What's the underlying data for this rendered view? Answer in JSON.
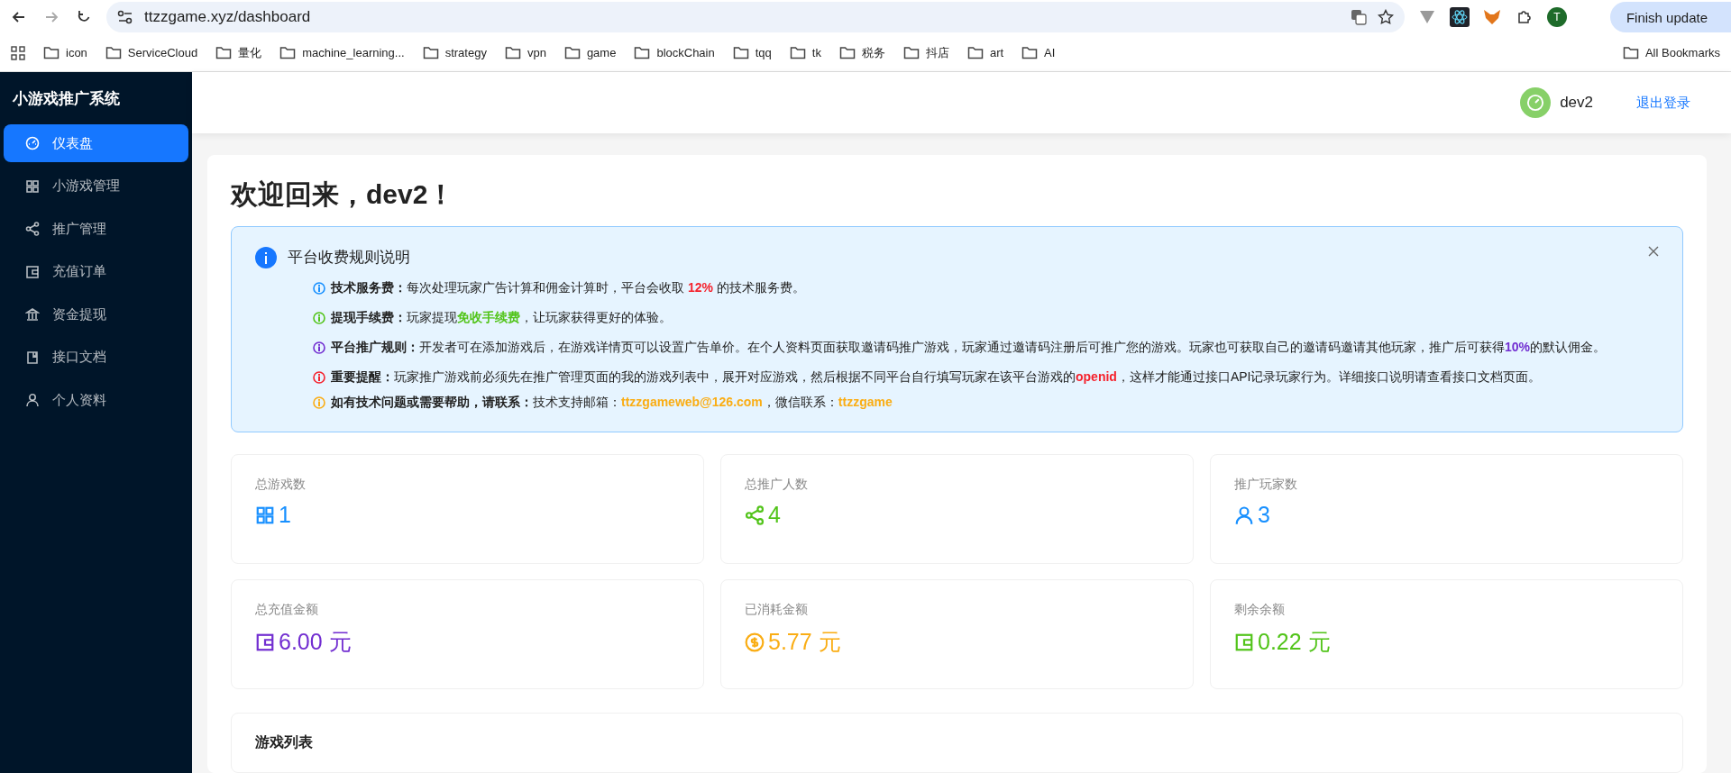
{
  "browser": {
    "url": "ttzzgame.xyz/dashboard",
    "profile_initial": "T",
    "update_button": "Finish update",
    "bookmarks": [
      "icon",
      "ServiceCloud",
      "量化",
      "machine_learning...",
      "strategy",
      "vpn",
      "game",
      "blockChain",
      "tqq",
      "tk",
      "税务",
      "抖店",
      "art",
      "AI"
    ],
    "all_bookmarks": "All Bookmarks"
  },
  "sidebar": {
    "title": "小游戏推广系统",
    "items": [
      {
        "label": "仪表盘",
        "kind": "dashboard",
        "selected": true
      },
      {
        "label": "小游戏管理",
        "kind": "grid",
        "selected": false
      },
      {
        "label": "推广管理",
        "kind": "share",
        "selected": false
      },
      {
        "label": "充值订单",
        "kind": "wallet",
        "selected": false
      },
      {
        "label": "资金提现",
        "kind": "bank",
        "selected": false
      },
      {
        "label": "接口文档",
        "kind": "book",
        "selected": false
      },
      {
        "label": "个人资料",
        "kind": "user",
        "selected": false
      }
    ]
  },
  "header": {
    "username": "dev2",
    "logout": "退出登录"
  },
  "welcome": "欢迎回来，dev2！",
  "notice": {
    "title": "平台收费规则说明",
    "rules": [
      {
        "color": "#1890ff",
        "title": "技术服务费：",
        "parts": [
          {
            "text": "每次处理玩家广告计算和佣金计算时，平台会收取 "
          },
          {
            "text": "12%",
            "color": "#f5222d"
          },
          {
            "text": " 的技术服务费。"
          }
        ]
      },
      {
        "color": "#52c41a",
        "title": "提现手续费：",
        "parts": [
          {
            "text": "玩家提现"
          },
          {
            "text": "免收手续费",
            "color": "#52c41a"
          },
          {
            "text": "，让玩家获得更好的体验。"
          }
        ]
      },
      {
        "color": "#722ed1",
        "title": "平台推广规则：",
        "parts": [
          {
            "text": "开发者可在添加游戏后，在游戏详情页可以设置广告单价。在个人资料页面获取邀请码推广游戏，玩家通过邀请码注册后可推广您的游戏。玩家也可获取自己的邀请码邀请其他玩家，推广后可获得"
          },
          {
            "text": "10%",
            "color": "#722ed1"
          },
          {
            "text": "的默认佣金。"
          }
        ]
      },
      {
        "color": "#f5222d",
        "title": "重要提醒：",
        "parts": [
          {
            "text": "玩家推广游戏前必须先在推广管理页面的我的游戏列表中，展开对应游戏，然后根据不同平台自行填写玩家在该平台游戏的"
          },
          {
            "text": "openid",
            "color": "#f5222d"
          },
          {
            "text": "，这样才能通过接口API记录玩家行为。详细接口说明请查看接口文档页面。"
          }
        ]
      },
      {
        "color": "#faad14",
        "title": "如有技术问题或需要帮助，请联系：",
        "parts": [
          {
            "text": "技术支持邮箱："
          },
          {
            "text": "ttzzgameweb@126.com",
            "color": "#faad14"
          },
          {
            "text": "，微信联系："
          },
          {
            "text": "ttzzgame",
            "color": "#faad14"
          }
        ]
      }
    ]
  },
  "stats": [
    {
      "label": "总游戏数",
      "value": "1",
      "kind": "grid",
      "color": "#1890ff"
    },
    {
      "label": "总推广人数",
      "value": "4",
      "kind": "share",
      "color": "#52c41a"
    },
    {
      "label": "推广玩家数",
      "value": "3",
      "kind": "user",
      "color": "#1890ff"
    },
    {
      "label": "总充值金额",
      "value": "6.00 元",
      "kind": "wallet",
      "color": "#722ed1"
    },
    {
      "label": "已消耗金额",
      "value": "5.77 元",
      "kind": "dollar",
      "color": "#faad14"
    },
    {
      "label": "剩余余额",
      "value": "0.22 元",
      "kind": "wallet",
      "color": "#52c41a"
    }
  ],
  "games_card": {
    "title": "游戏列表"
  }
}
